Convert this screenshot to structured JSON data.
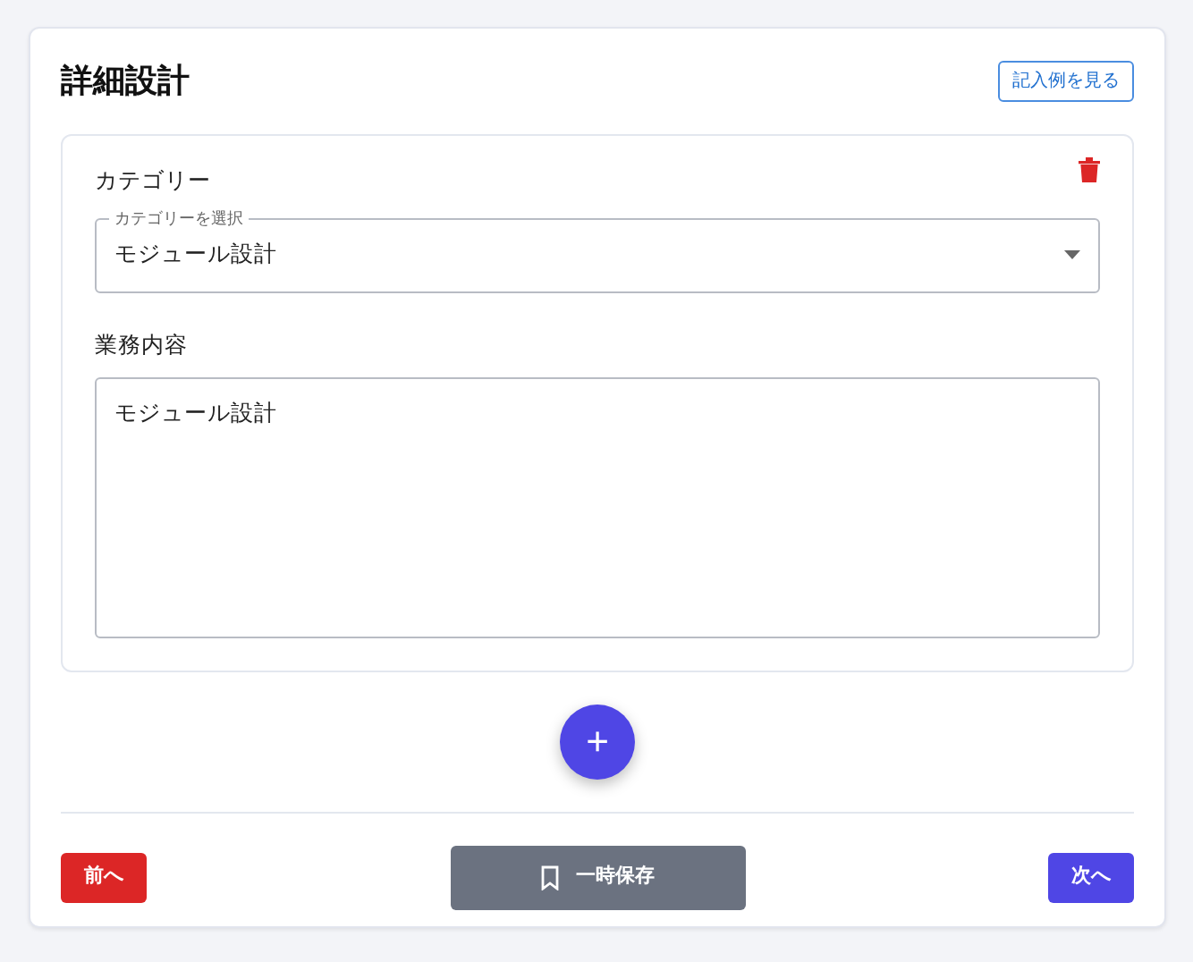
{
  "title": "詳細設計",
  "example_button": "記入例を見る",
  "entries": [
    {
      "category_label": "カテゴリー",
      "select_legend": "カテゴリーを選択",
      "select_value": "モジュール設計",
      "content_label": "業務内容",
      "content_value": "モジュール設計"
    }
  ],
  "add_button": "+",
  "footer": {
    "prev": "前へ",
    "save": "一時保存",
    "next": "次へ"
  }
}
